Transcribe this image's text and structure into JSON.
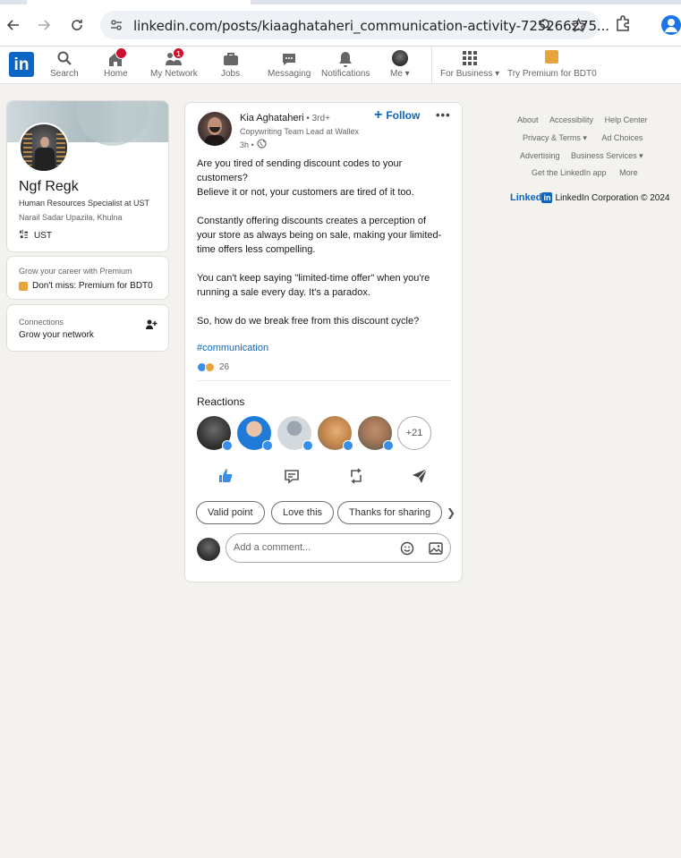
{
  "browser": {
    "url": "linkedin.com/posts/kiaaghataheri_communication-activity-725266275..."
  },
  "nav": {
    "logo": "in",
    "items": [
      {
        "label": "Search"
      },
      {
        "label": "Home",
        "badge": ""
      },
      {
        "label": "My Network",
        "badge": "1"
      },
      {
        "label": "Jobs"
      },
      {
        "label": "Messaging"
      },
      {
        "label": "Notifications"
      },
      {
        "label": "Me ▾"
      },
      {
        "label": "For Business ▾"
      },
      {
        "label": "Try Premium for BDT0"
      }
    ]
  },
  "profile": {
    "name": "Ngf Regk",
    "headline": "Human Resources Specialist at UST",
    "location": "Narail Sadar Upazila, Khulna",
    "org": "UST"
  },
  "premium": {
    "subtitle": "Grow your career with Premium",
    "link": "Don't miss: Premium for BDT0"
  },
  "connections": {
    "title": "Connections",
    "subtitle": "Grow your network"
  },
  "post": {
    "author": "Kia Aghataheri",
    "degree": " • 3rd+",
    "headline": "Copywriting Team Lead at Wallex",
    "time": "3h •",
    "follow": "Follow",
    "more": "•••",
    "body": [
      "Are you tired of sending discount codes to your",
      "customers?",
      "Believe it or not, your customers are tired of it too.",
      "",
      "Constantly offering discounts creates a perception of",
      "your store as always being on sale, making your limited-",
      "time offers less compelling.",
      "",
      "You can't keep saying \"limited-time offer\" when you're",
      "running a sale every day. It's a paradox.",
      "",
      "So, how do we break free from this discount cycle?"
    ],
    "hashtag": "#communication",
    "reaction_count": "26",
    "reactions_title": "Reactions",
    "more_reactors": "+21",
    "chips": [
      "Valid point",
      "Love this",
      "Thanks for sharing"
    ],
    "chip_arrow": "❯",
    "comment_placeholder": "Add a comment..."
  },
  "footer": {
    "row1": [
      "About",
      "Accessibility",
      "Help Center"
    ],
    "row2": [
      "Privacy & Terms ▾",
      "Ad Choices"
    ],
    "row3": [
      "Advertising",
      "Business Services ▾"
    ],
    "row4": [
      "Get the LinkedIn app",
      "More"
    ],
    "brand_word": "Linked",
    "brand_in": "in",
    "copyright": "LinkedIn Corporation © 2024"
  },
  "colors": {
    "brand": "#0a66c2",
    "badge": "#cb112d",
    "background": "#f4f2ee"
  }
}
